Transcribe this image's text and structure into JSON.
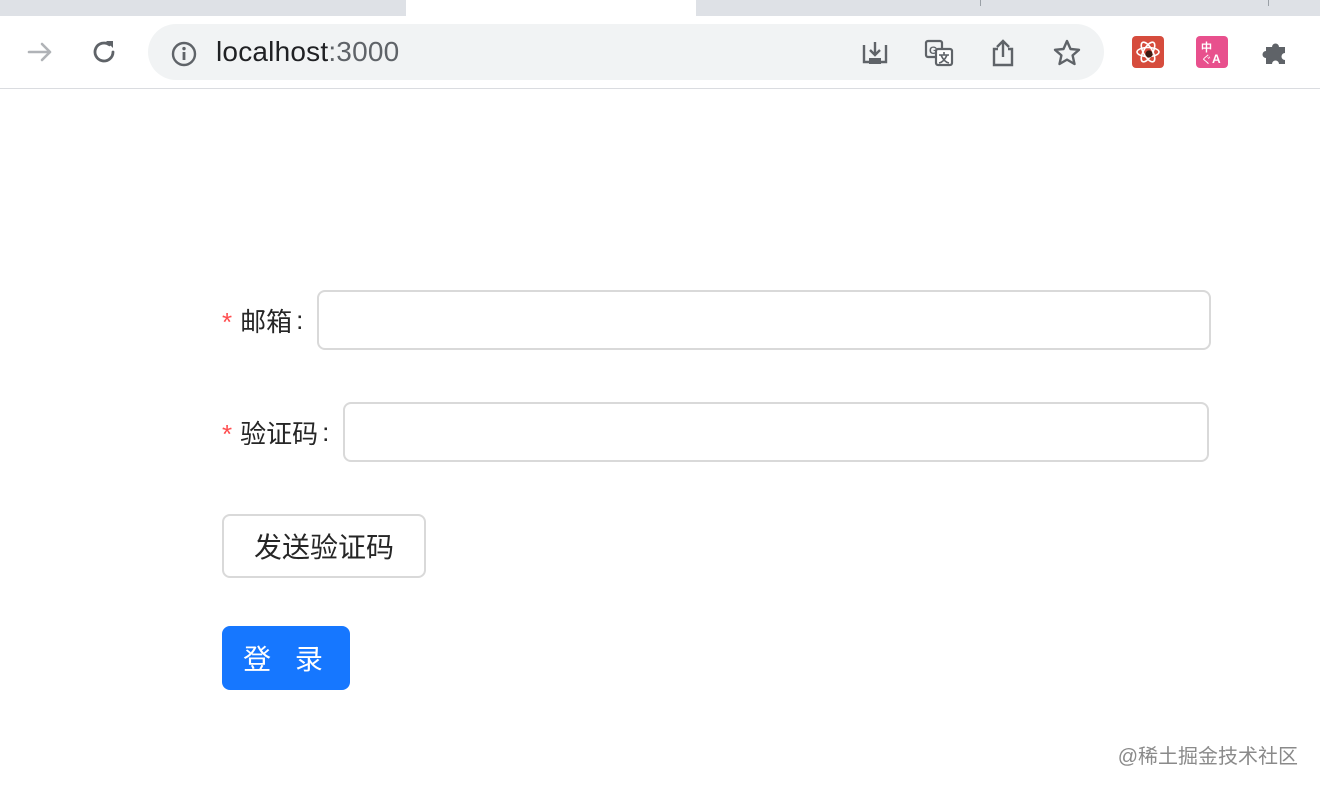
{
  "browser": {
    "url_host": "localhost",
    "url_port": ":3000",
    "icons": [
      "forward-icon",
      "reload-icon",
      "site-info-icon",
      "install-app-icon",
      "translate-icon",
      "share-icon",
      "bookmark-star-icon",
      "react-devtools-extension-icon",
      "translate-extension-icon",
      "extensions-puzzle-icon"
    ]
  },
  "form": {
    "email": {
      "required_mark": "*",
      "label": "邮箱",
      "colon": ":",
      "value": ""
    },
    "code": {
      "required_mark": "*",
      "label": "验证码",
      "colon": ":",
      "value": ""
    },
    "send_code_button": "发送验证码",
    "login_button": "登 录"
  },
  "colors": {
    "primary": "#1677ff",
    "required": "#ff4d4f",
    "border": "#d9d9d9"
  },
  "watermark": "@稀土掘金技术社区"
}
